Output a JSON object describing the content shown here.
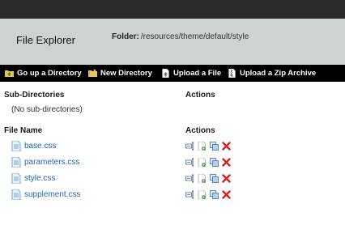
{
  "header": {
    "title": "File Explorer",
    "folder_label": "Folder:",
    "folder_path": "/resources/theme/default/style"
  },
  "toolbar": {
    "items": [
      {
        "label": "Go up a Directory",
        "icon": "folder-up-icon"
      },
      {
        "label": "New Directory",
        "icon": "folder-new-icon"
      },
      {
        "label": "Upload a File",
        "icon": "file-upload-icon"
      },
      {
        "label": "Upload a Zip Archive",
        "icon": "zip-upload-icon"
      }
    ]
  },
  "subdirs": {
    "heading": "Sub-Directories",
    "actions_heading": "Actions",
    "empty_text": "(No sub-directories)"
  },
  "files": {
    "heading": "File Name",
    "actions_heading": "Actions",
    "items": [
      {
        "name": "base.css"
      },
      {
        "name": "parameters.css"
      },
      {
        "name": "style.css"
      },
      {
        "name": "supplement.css"
      }
    ],
    "action_icons": [
      "rename-icon",
      "edit-file-icon",
      "copy-icon",
      "delete-icon"
    ]
  },
  "colors": {
    "topbar": "#2a2a2a",
    "header_bg": "#cdd3d0",
    "toolbar_bg": "#000000",
    "link": "#1f66b8",
    "delete": "#d62020"
  }
}
